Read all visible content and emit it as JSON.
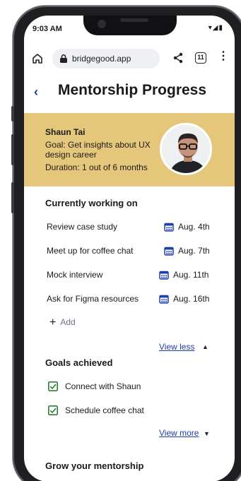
{
  "status_bar": {
    "time": "9:03 AM",
    "icons": "▾◢▮"
  },
  "browser": {
    "url": "bridgegood.app",
    "tab_count": "11"
  },
  "page": {
    "title": "Mentorship Progress"
  },
  "mentor": {
    "name": "Shaun Tai",
    "goal": "Goal: Get insights about UX design career",
    "duration": "Duration: 1 out of 6 months"
  },
  "working": {
    "title": "Currently working on",
    "items": [
      {
        "label": "Review case study",
        "date": "Aug. 4th"
      },
      {
        "label": "Meet up for coffee chat",
        "date": "Aug. 7th"
      },
      {
        "label": "Mock interview",
        "date": "Aug. 11th"
      },
      {
        "label": "Ask for Figma resources",
        "date": "Aug. 16th"
      }
    ],
    "add_label": "Add",
    "view_less": "View less"
  },
  "goals": {
    "title": "Goals achieved",
    "items": [
      {
        "label": "Connect with Shaun",
        "checked": true
      },
      {
        "label": "Schedule coffee chat",
        "checked": true
      }
    ],
    "view_more": "View more"
  },
  "grow": {
    "title": "Grow your mentorship"
  },
  "colors": {
    "banner": "#e4c77a",
    "link": "#1e40af",
    "calendar": "#1e40af",
    "check": "#2e7d32"
  }
}
